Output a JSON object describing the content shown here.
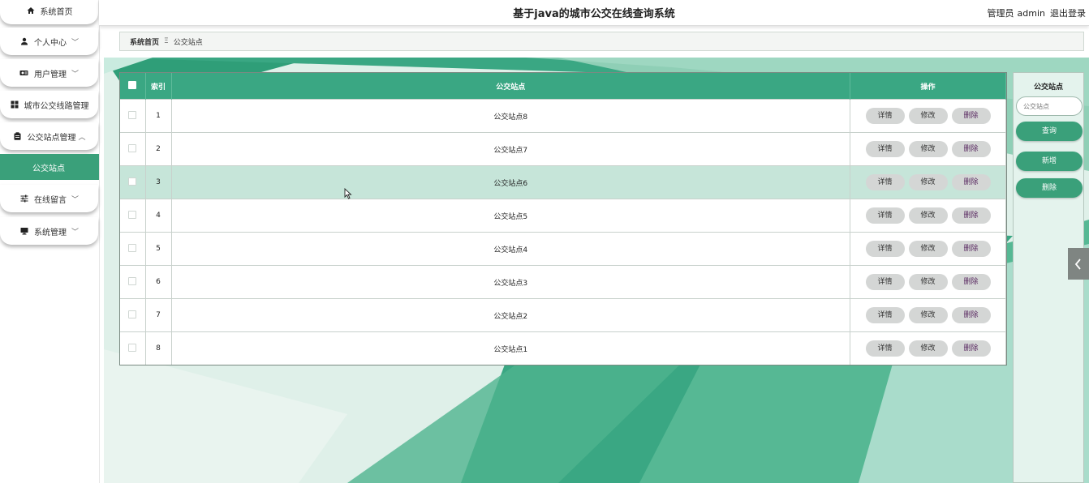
{
  "header": {
    "title": "基于java的城市公交在线查询系统",
    "role": "管理员",
    "user": "admin",
    "logout": "退出登录"
  },
  "sidebar": {
    "items": [
      {
        "label": "系统首页",
        "icon": "home-icon",
        "chevron": ""
      },
      {
        "label": "个人中心",
        "icon": "user-icon",
        "chevron": "﹀"
      },
      {
        "label": "用户管理",
        "icon": "users-icon",
        "chevron": "﹀"
      },
      {
        "label": "城市公交线路管理",
        "icon": "grid-icon",
        "chevron": ""
      },
      {
        "label": "公交站点管理",
        "icon": "clipboard-icon",
        "chevron": "︿"
      },
      {
        "label": "在线留言",
        "icon": "sliders-icon",
        "chevron": "﹀"
      },
      {
        "label": "系统管理",
        "icon": "monitor-icon",
        "chevron": "﹀"
      }
    ],
    "active_sub": "公交站点"
  },
  "breadcrumb": {
    "home": "系统首页",
    "sep": "Ξ",
    "current": "公交站点"
  },
  "table": {
    "headers": {
      "index": "索引",
      "name": "公交站点",
      "ops": "操作"
    },
    "actions": {
      "detail": "详情",
      "edit": "修改",
      "delete": "删除"
    },
    "rows": [
      {
        "index": "1",
        "name": "公交站点8"
      },
      {
        "index": "2",
        "name": "公交站点7"
      },
      {
        "index": "3",
        "name": "公交站点6"
      },
      {
        "index": "4",
        "name": "公交站点5"
      },
      {
        "index": "5",
        "name": "公交站点4"
      },
      {
        "index": "6",
        "name": "公交站点3"
      },
      {
        "index": "7",
        "name": "公交站点2"
      },
      {
        "index": "8",
        "name": "公交站点1"
      }
    ],
    "highlight_row": 2
  },
  "search": {
    "title": "公交站点",
    "placeholder": "公交站点",
    "query_btn": "查询",
    "add_btn": "新增",
    "delete_btn": "删除"
  },
  "colors": {
    "accent": "#3aa07a",
    "header_row": "#3aa783",
    "highlight": "#c6e5d9"
  }
}
